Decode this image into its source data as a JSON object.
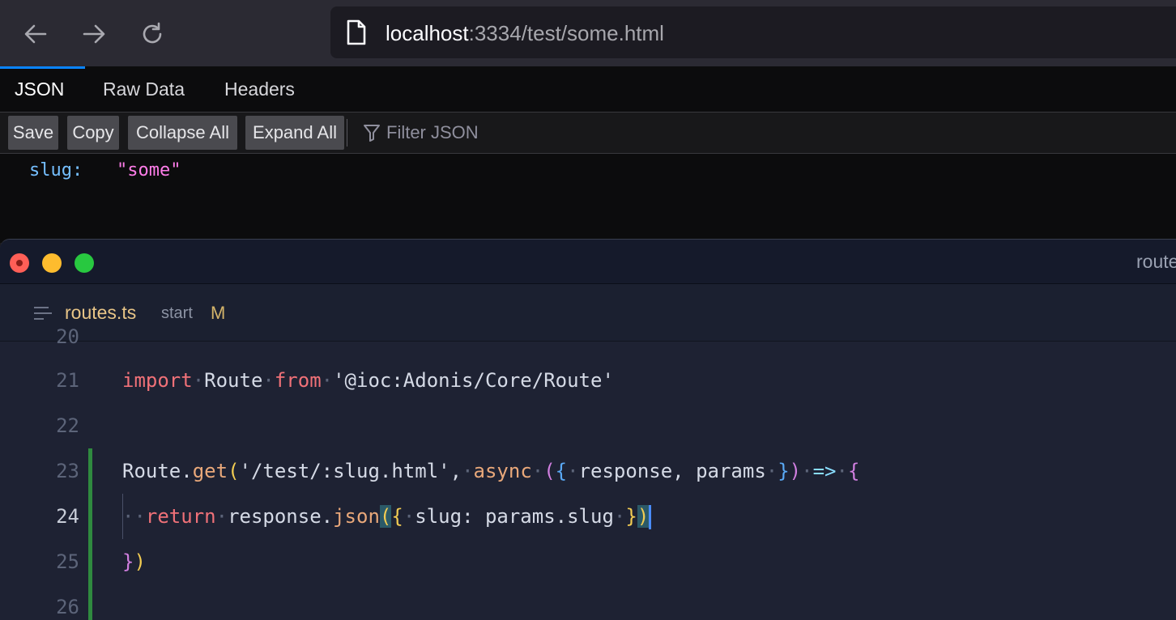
{
  "browser": {
    "url_host": "localhost",
    "url_rest": ":3334/test/some.html",
    "tabs": [
      {
        "label": "JSON",
        "active": true
      },
      {
        "label": "Raw Data",
        "active": false
      },
      {
        "label": "Headers",
        "active": false
      }
    ],
    "toolbar": {
      "save": "Save",
      "copy": "Copy",
      "collapse_all": "Collapse All",
      "expand_all": "Expand All",
      "filter_placeholder": "Filter JSON"
    },
    "json": {
      "key": "slug:",
      "value": "\"some\""
    }
  },
  "editor": {
    "window_title": "route",
    "file": {
      "name": "routes.ts",
      "branch": "start",
      "status": "M"
    },
    "lines": [
      {
        "number": "20"
      },
      {
        "number": "21",
        "tokens": {
          "import": "import",
          "route": "Route",
          "from": "from",
          "path": "'@ioc:Adonis/Core/Route'"
        }
      },
      {
        "number": "22"
      },
      {
        "number": "23",
        "tokens": {
          "obj": "Route",
          "method": "get",
          "path": "'/test/:slug.html'",
          "async": "async",
          "params": "response, params",
          "arrow": "=>"
        }
      },
      {
        "number": "24",
        "tokens": {
          "return": "return",
          "obj": "response.",
          "fn": "json",
          "body": "slug: params.slug"
        }
      },
      {
        "number": "25",
        "tokens": {
          "close": "}"
        }
      },
      {
        "number": "26"
      }
    ]
  },
  "colors": {
    "accent_tab": "#0a84ff",
    "json_key": "#75bfff",
    "json_string": "#ff7de9",
    "editor_bg": "#1e2233",
    "keyword": "#f07178",
    "git_added": "#2f8a3f"
  }
}
